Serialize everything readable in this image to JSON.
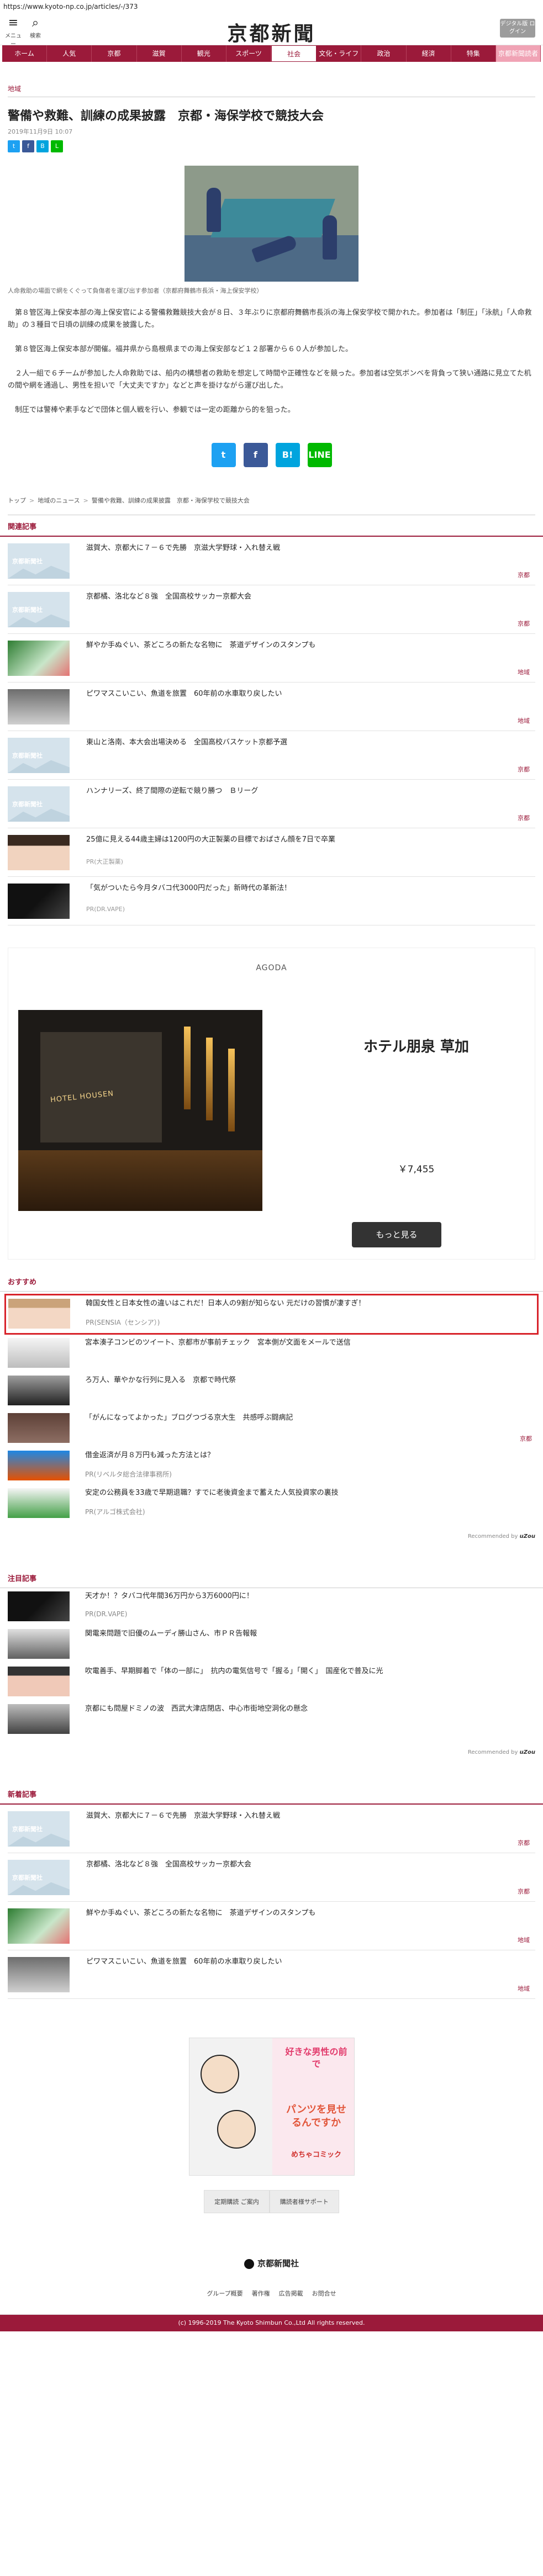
{
  "browser": {
    "url": "https://www.kyoto-np.co.jp/articles/-/373"
  },
  "header": {
    "menu_label": "メニュー",
    "search_label": "検索",
    "logo": "京都新聞",
    "edition_button": "デジタル版 ログイン"
  },
  "nav": {
    "items": [
      "ホーム",
      "人気",
      "京都",
      "滋賀",
      "観光",
      "スポーツ",
      "社会",
      "文化・ライフ",
      "政治",
      "経済",
      "特集",
      "京都新聞読者"
    ],
    "active_index": 6,
    "accent": "#9b1a3a"
  },
  "article": {
    "category": "地域",
    "title": "警備や救難、訓練の成果披露　京都・海保学校で競技大会",
    "date": "2019年11月9日 10:07",
    "share_mini": [
      {
        "icon": "twitter-icon",
        "label": "t",
        "color": "#1da1f2"
      },
      {
        "icon": "facebook-icon",
        "label": "f",
        "color": "#3b5998"
      },
      {
        "icon": "hatena-icon",
        "label": "B",
        "color": "#00a4de"
      },
      {
        "icon": "line-icon",
        "label": "L",
        "color": "#00b900"
      }
    ],
    "caption": "人命救助の場面で網をくぐって負傷者を運び出す参加者（京都府舞鶴市長浜・海上保安学校）",
    "paragraphs": [
      "　第８管区海上保安本部の海上保安官による警備救難競技大会が８日、３年ぶりに京都府舞鶴市長浜の海上保安学校で開かれた。参加者は「制圧」「泳航」「人命救助」の３種目で日頃の訓練の成果を披露した。",
      "　第８管区海上保安本部が開催。福井県から島根県までの海上保安部など１２部署から６０人が参加した。",
      "　２人一組で６チームが参加した人命救助では、船内の構想者の救助を想定して時間や正確性などを競った。参加者は空気ボンベを背負って狭い通路に見立てた机の間や網を通過し、男性を担いで「大丈夫ですか」などと声を掛けながら運び出した。",
      "　制圧では警棒や素手などで団体と個人戦を行い、参観では一定の距離から的を狙った。"
    ],
    "share_big": [
      {
        "icon": "twitter-icon",
        "label": "t",
        "color": "#1da1f2"
      },
      {
        "icon": "facebook-icon",
        "label": "f",
        "color": "#3b5998"
      },
      {
        "icon": "hatena-icon",
        "label": "B!",
        "color": "#00a4de"
      },
      {
        "icon": "line-icon",
        "label": "LINE",
        "color": "#00b900"
      }
    ],
    "breadcrumb": [
      "トップ",
      "地域のニュース",
      "警備や救難、訓練の成果披露　京都・海保学校で競技大会"
    ]
  },
  "related": {
    "title": "関連記事",
    "placeholder_text": "京都新聞社",
    "items": [
      {
        "title": "滋賀大、京都大に７－６で先勝　京滋大学野球・入れ替え戦",
        "tag": "京都",
        "thumb": "placeholder"
      },
      {
        "title": "京都橘、洛北など８強　全国高校サッカー京都大会",
        "tag": "京都",
        "thumb": "placeholder"
      },
      {
        "title": "鮮やか手ぬぐい、茶どころの新たな名物に　茶道デザインのスタンプも",
        "tag": "地域",
        "thumb": "green"
      },
      {
        "title": "ピワマスこいこい、魚道を旅置　60年前の水車取り戻したい",
        "tag": "地域",
        "thumb": "stone"
      },
      {
        "title": "東山と洛南、本大会出場決める　全国高校バスケット京都予選",
        "tag": "京都",
        "thumb": "placeholder"
      },
      {
        "title": "ハンナリーズ、終了間際の逆転で競り勝つ　Ｂリーグ",
        "tag": "京都",
        "thumb": "placeholder"
      },
      {
        "title": "25億に見える44歳主婦は1200円の大正製薬の目標でおばさん顔を7日で卒業",
        "sub": "PR(大正製薬)",
        "thumb": "woman"
      },
      {
        "title": "「気がついたら今月タバコ代3000円だった」新時代の革新法！",
        "sub": "PR(DR.VAPE)",
        "thumb": "vape"
      }
    ]
  },
  "ad": {
    "provider": "AGODA",
    "hotel": "ホテル朋泉 草加",
    "price": "￥7,455",
    "button": "もっと見る",
    "image_sign": "HOTEL HOUSEN"
  },
  "recommend": {
    "title": "おすすめ",
    "items": [
      {
        "text": "韓国女性と日本女性の違いはこれだ！日本人の9割が知らない 元だけの習慣が凄すぎ！",
        "pr": "PR(SENSIA（センシア）)",
        "thumb": "woman2",
        "highlight": true
      },
      {
        "text": "宮本湊子コンビのツイート、京都市が事前チェック　宮本側が文面をメールで送信",
        "thumb": "letter"
      },
      {
        "text": "ろ万人、華やかな行列に見入る　京都で時代祭",
        "thumb": "parade"
      },
      {
        "text": "「がんになってよかった」ブログつづる京大生　共感呼ぶ闘病記",
        "thumb": "student"
      },
      {
        "text": "借金返済が月８万円も減った方法とは？",
        "pr": "PR(リベルタ総合法律事務所)",
        "thumb": "city"
      },
      {
        "text": "安定の公務員を33歳で早期退職？すでに老後資金まで蓄えた人気投資家の裏技",
        "pr": "PR(アルゴ株式会社)",
        "thumb": "chart"
      }
    ],
    "tags": [
      "",
      "",
      "",
      "京都",
      "",
      ""
    ],
    "powered": "Recommended by",
    "powered_brand": "uZou"
  },
  "attention": {
    "title": "注目記事",
    "items": [
      {
        "text": "天才か！？タバコ代年間36万円から3万6000円に！",
        "pr": "PR(DR.VAPE)",
        "thumb": "vape"
      },
      {
        "text": "関電来問題で旧優のムーディ勝山さん、市ＰＲ告報報",
        "thumb": "building"
      },
      {
        "text": "吹電善手、早期脚着で「体の一部に」　抗内の電気信号で「握る」「開く」　国産化で普及に光",
        "thumb": "woman3"
      },
      {
        "text": "京都にも問屋ドミノの波　西武大津店閉店、中心市街地空洞化の懸念",
        "thumb": "street"
      }
    ],
    "powered": "Recommended by",
    "powered_brand": "uZou"
  },
  "newest": {
    "title": "新着記事",
    "items": [
      {
        "title": "滋賀大、京都大に７－６で先勝　京滋大学野球・入れ替え戦",
        "tag": "京都",
        "thumb": "placeholder"
      },
      {
        "title": "京都橘、洛北など８強　全国高校サッカー京都大会",
        "tag": "京都",
        "thumb": "placeholder"
      },
      {
        "title": "鮮やか手ぬぐい、茶どころの新たな名物に　茶道デザインのスタンプも",
        "tag": "地域",
        "thumb": "green"
      },
      {
        "title": "ピワマスこいこい、魚道を旅置　60年前の水車取り戻したい",
        "tag": "地域",
        "thumb": "stone"
      }
    ]
  },
  "banner": {
    "line1": "好きな男性の前で",
    "line2": "パンツを見せるんですか",
    "line3": "めちゃコミック"
  },
  "footer": {
    "buttons": [
      "定期購読 ご案内",
      "購読者様サポート"
    ],
    "logo": "京都新聞社",
    "links": [
      "グループ概要",
      "著作権",
      "広告掲載",
      "お問合せ"
    ],
    "copyright": "(c) 1996-2019 The Kyoto Shimbun Co.,Ltd All rights reserved."
  }
}
